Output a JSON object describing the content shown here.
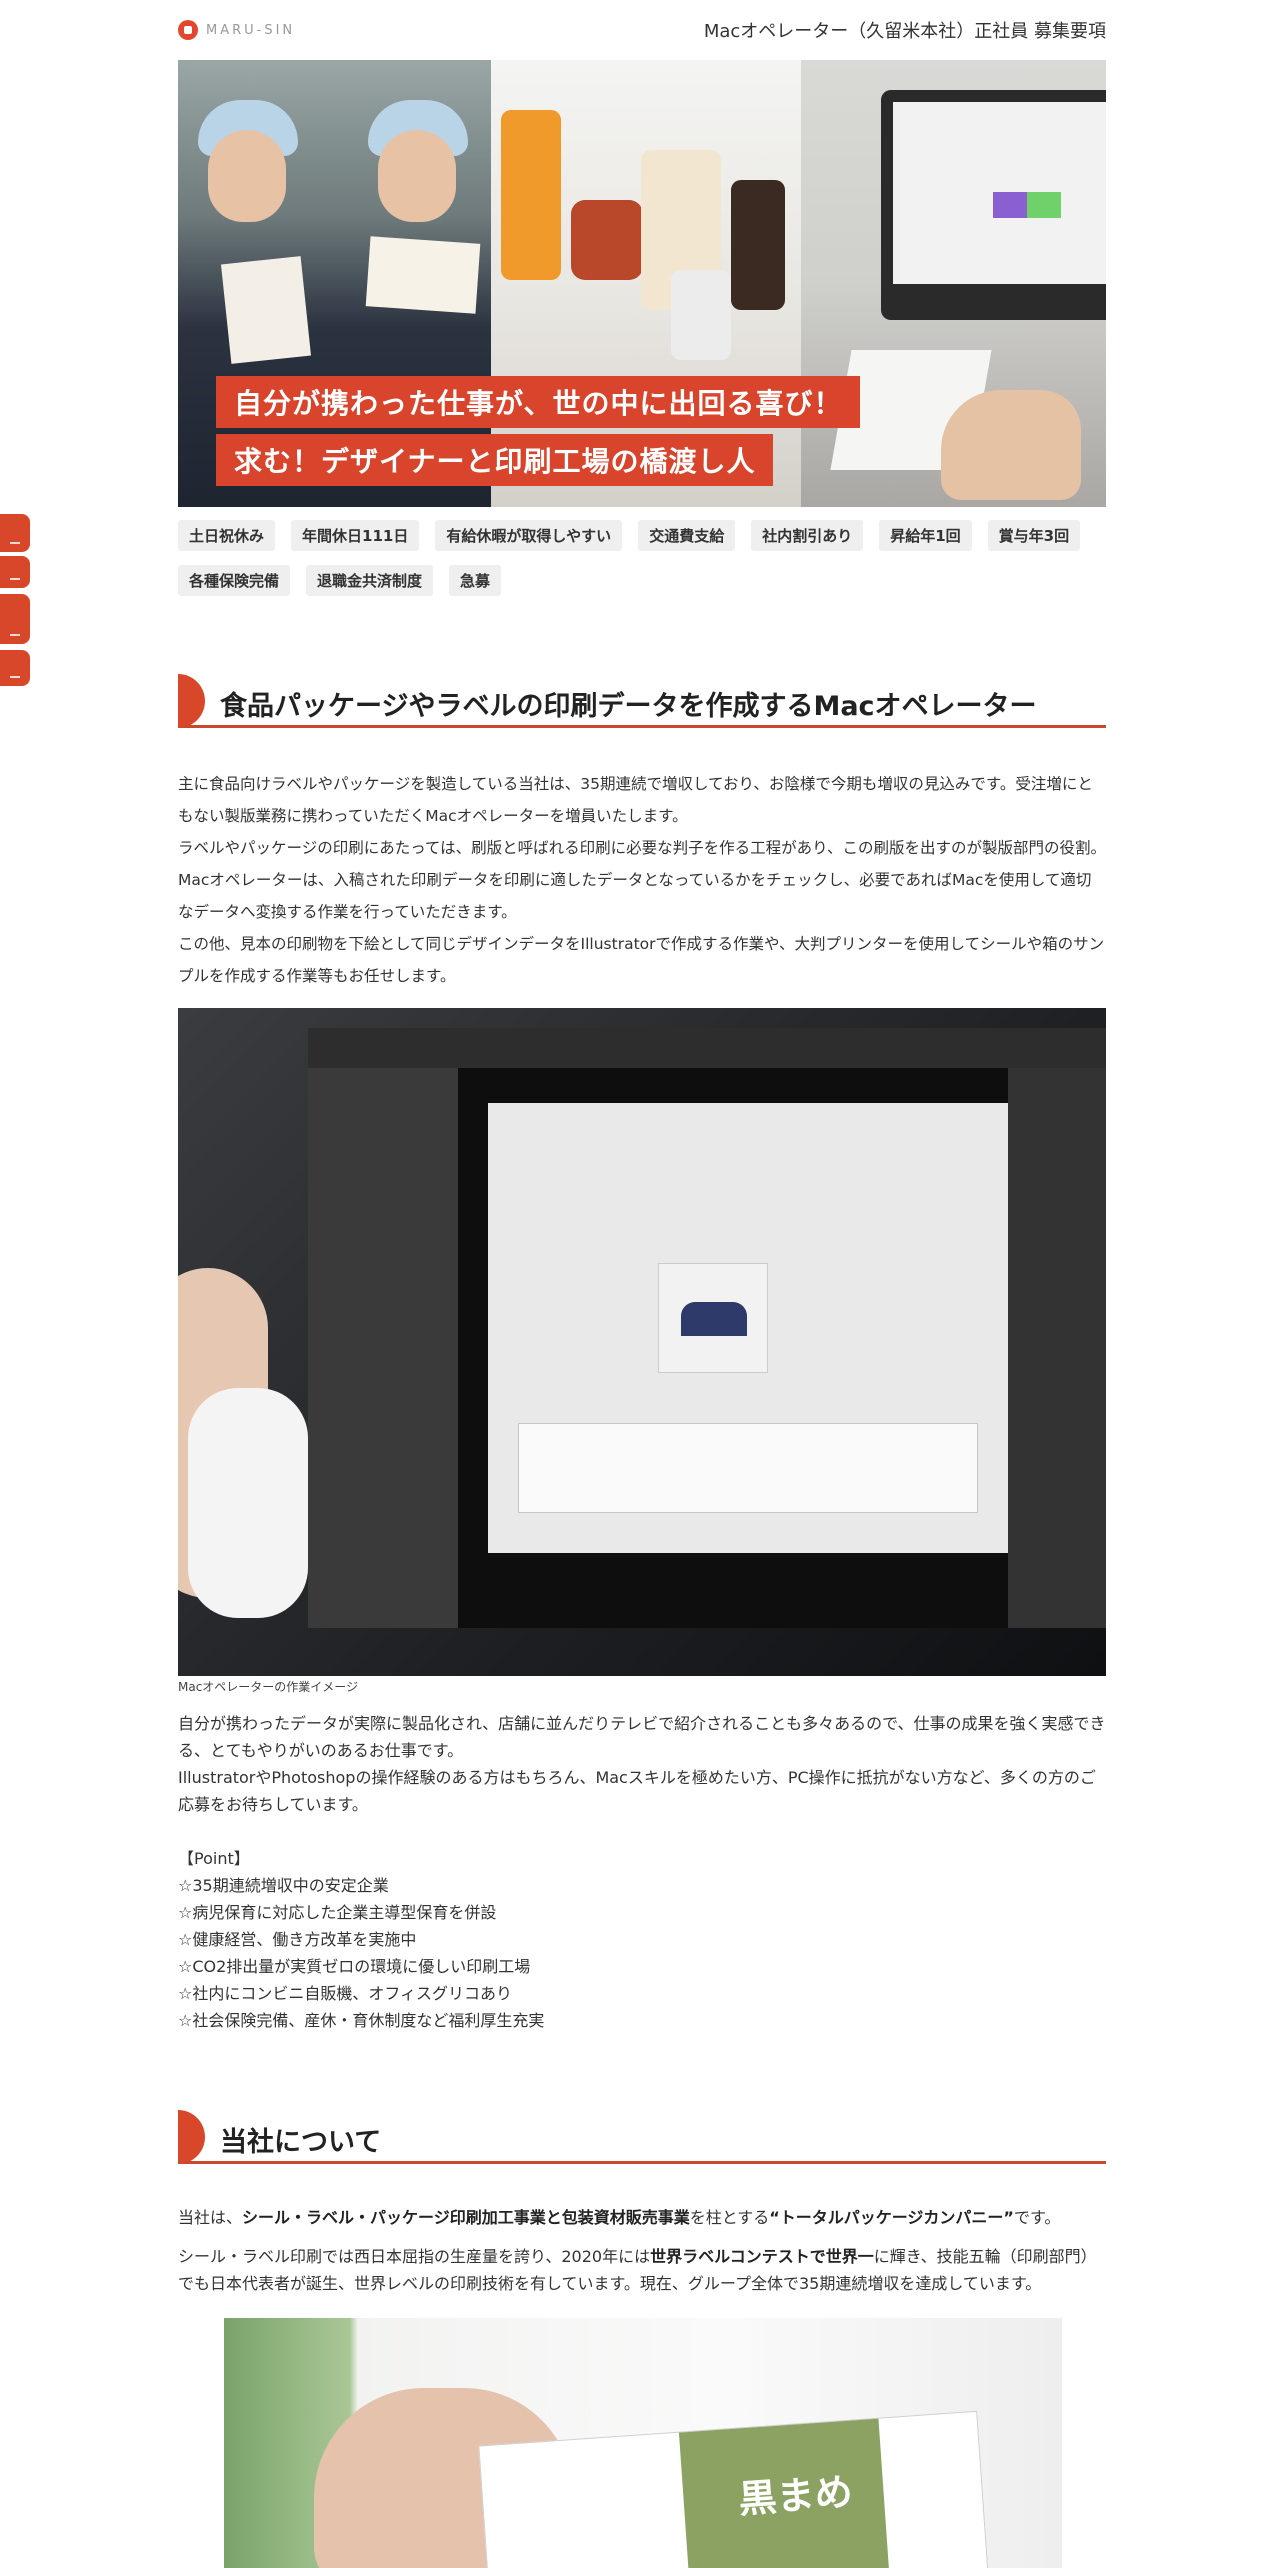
{
  "header": {
    "logo_text": "MARU-SIN",
    "job_title": "Macオペレーター（久留米本社）正社員 募集要項"
  },
  "hero": {
    "caption_1": "自分が携わった仕事が、世の中に出回る喜び！",
    "caption_2": "求む！デザイナーと印刷工場の橋渡し人"
  },
  "tags": [
    "土日祝休み",
    "年間休日111日",
    "有給休暇が取得しやすい",
    "交通費支給",
    "社内割引あり",
    "昇給年1回",
    "賞与年3回",
    "各種保険完備",
    "退職金共済制度",
    "急募"
  ],
  "section1": {
    "heading": "食品パッケージやラベルの印刷データを作成するMacオペレーター",
    "paragraphs": [
      "主に食品向けラベルやパッケージを製造している当社は、35期連続で増収しており、お陰様で今期も増収の見込みです。受注増にともない製版業務に携わっていただくMacオペレーターを増員いたします。",
      "ラベルやパッケージの印刷にあたっては、刷版と呼ばれる印刷に必要な判子を作る工程があり、この刷版を出すのが製版部門の役割。Macオペレーターは、入稿された印刷データを印刷に適したデータとなっているかをチェックし、必要であればMacを使用して適切なデータへ変換する作業を行っていただきます。",
      "この他、見本の印刷物を下絵として同じデザインデータをIllustratorで作成する作業や、大判プリンターを使用してシールや箱のサンプルを作成する作業等もお任せします。"
    ],
    "photo_caption": "Macオペレーターの作業イメージ",
    "body": [
      "自分が携わったデータが実際に製品化され、店舗に並んだりテレビで紹介されることも多々あるので、仕事の成果を強く実感できる、とてもやりがいのあるお仕事です。",
      "IllustratorやPhotoshopの操作経験のある方はもちろん、Macスキルを極めたい方、PC操作に抵抗がない方など、多くの方のご応募をお待ちしています。",
      "",
      "【Point】",
      "☆35期連続増収中の安定企業",
      "☆病児保育に対応した企業主導型保育を併設",
      "☆健康経営、働き方改革を実施中",
      "☆CO2排出量が実質ゼロの環境に優しい印刷工場",
      "☆社内にコンビニ自販機、オフィスグリコあり",
      "☆社会保険完備、産休・育休制度など福利厚生充実"
    ]
  },
  "section2": {
    "heading": "当社について",
    "p1_a": "当社は、",
    "p1_b": "シール・ラベル・パッケージ印刷加工事業と包装資材販売事業",
    "p1_c": "を柱とする",
    "p1_d": "“トータルパッケージカンパニー”",
    "p1_e": "です。",
    "p2_a": "シール・ラベル印刷では西日本屈指の生産量を誇り、2020年には",
    "p2_b": "世界ラベルコンテストで世界一",
    "p2_c": "に輝き、技能五輪（印刷部門）でも日本代表者が誕生、世界レベルの印刷技術を有しています。現在、グループ全体で35期連続増収を達成しています。",
    "photo_text": "黒まめ"
  },
  "colors": {
    "accent": "#d9472b",
    "text": "#333333",
    "tag_bg": "#efefef"
  }
}
